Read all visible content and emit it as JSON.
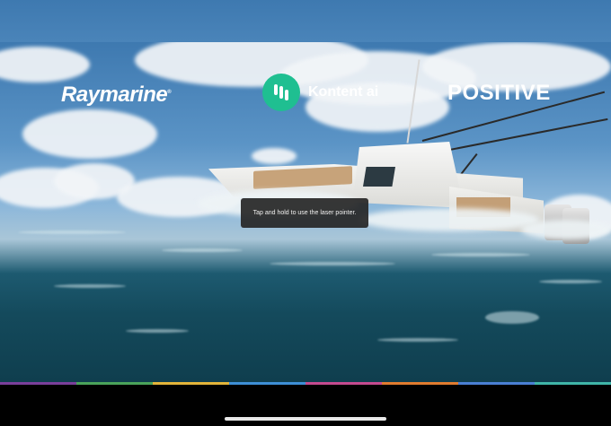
{
  "window": {
    "menu_icon": "more-dots-icon"
  },
  "slide": {
    "logos": {
      "raymarine": "Raymarine",
      "raymarine_mark": "®",
      "kontent": "Kontent ai",
      "kontent_icon": "kontent-logo-icon",
      "positive": "POSITIVE"
    },
    "tooltip": "Tap and hold to use the laser pointer."
  },
  "progress": {
    "segments": [
      "#7a3f9a",
      "#4aa35a",
      "#e2b43a",
      "#3e8fd6",
      "#c44b8f",
      "#e07b2f",
      "#4a7fd4",
      "#3fb5a8"
    ]
  },
  "colors": {
    "kontent_green": "#1fbf91",
    "background": "#000000"
  }
}
